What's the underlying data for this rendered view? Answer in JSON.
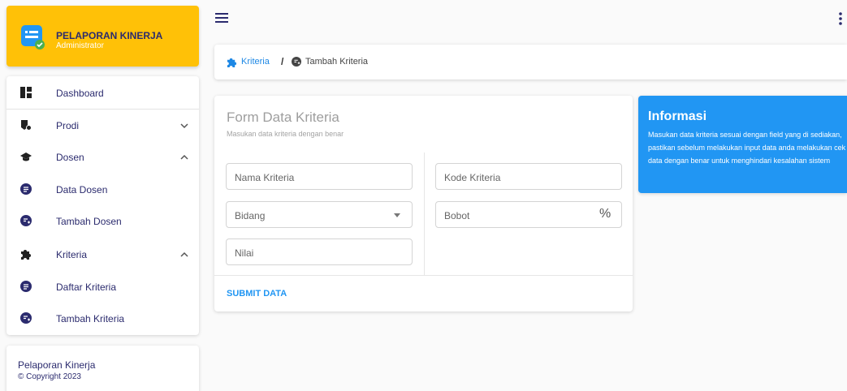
{
  "brand": {
    "title": "PELAPORAN KINERJA",
    "role": "Administrator"
  },
  "sidebar": {
    "items": [
      {
        "label": "Dashboard",
        "icon": "dashboard-icon",
        "chevron": ""
      },
      {
        "label": "Prodi",
        "icon": "prodi-icon",
        "chevron": "down"
      },
      {
        "label": "Dosen",
        "icon": "graduation-cap-icon",
        "chevron": "up"
      },
      {
        "label": "Data Dosen",
        "icon": "list-circle-icon",
        "chevron": ""
      },
      {
        "label": "Tambah Dosen",
        "icon": "add-circle-icon",
        "chevron": ""
      },
      {
        "label": "Kriteria",
        "icon": "puzzle-icon",
        "chevron": "up"
      },
      {
        "label": "Daftar Kriteria",
        "icon": "list-circle-icon",
        "chevron": ""
      },
      {
        "label": "Tambah Kriteria",
        "icon": "add-circle-icon",
        "chevron": ""
      }
    ]
  },
  "footer": {
    "title": "Pelaporan Kinerja",
    "copyright": "© Copyright 2023"
  },
  "breadcrumb": {
    "parent": "Kriteria",
    "separator": "/",
    "current": "Tambah Kriteria"
  },
  "form": {
    "title": "Form Data Kriteria",
    "subtitle": "Masukan data kriteria dengan benar",
    "fields": {
      "nama_kriteria": {
        "placeholder": "Nama Kriteria",
        "value": ""
      },
      "kode_kriteria": {
        "placeholder": "Kode Kriteria",
        "value": ""
      },
      "bidang": {
        "placeholder": "Bidang",
        "value": ""
      },
      "bobot": {
        "placeholder": "Bobot",
        "value": "",
        "suffix": "%"
      },
      "nilai": {
        "placeholder": "Nilai",
        "value": ""
      }
    },
    "submit_label": "SUBMIT DATA"
  },
  "info": {
    "title": "Informasi",
    "text": "Masukan data kriteria sesuai dengan field yang di sediakan, pastikan sebelum melakukan input data anda melakukan cek data dengan benar untuk menghindari kesalahan sistem"
  },
  "colors": {
    "brand": "#ffc107",
    "primary": "#2196f3",
    "nav_text": "#2b2b6e",
    "link": "#1e88e5"
  }
}
